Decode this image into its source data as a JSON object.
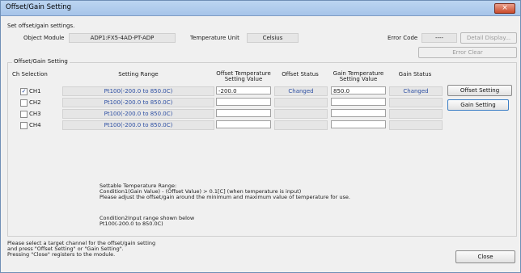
{
  "window": {
    "title": "Offset/Gain Setting",
    "close_glyph": "×"
  },
  "intro": "Set offset/gain settings.",
  "module": {
    "label": "Object Module",
    "value": "ADP1:FX5-4AD-PT-ADP"
  },
  "temp_unit": {
    "label": "Temperature Unit",
    "value": "Celsius"
  },
  "error": {
    "label": "Error Code",
    "value": "----",
    "detail_label": "Detail Display...",
    "clear_label": "Error Clear"
  },
  "group_label": "Offset/Gain Setting",
  "headers": {
    "ch": "Ch Selection",
    "range": "Setting Range",
    "offset_val": "Offset Temperature\nSetting Value",
    "offset_status": "Offset Status",
    "gain_val": "Gain Temperature\nSetting Value",
    "gain_status": "Gain Status"
  },
  "channels": [
    {
      "name": "CH1",
      "checked": true,
      "range": "Pt100(-200.0 to 850.0C)",
      "offset": "-200.0",
      "offset_status": "Changed",
      "gain": "850.0",
      "gain_status": "Changed"
    },
    {
      "name": "CH2",
      "checked": false,
      "range": "Pt100(-200.0 to 850.0C)",
      "offset": "",
      "offset_status": "",
      "gain": "",
      "gain_status": ""
    },
    {
      "name": "CH3",
      "checked": false,
      "range": "Pt100(-200.0 to 850.0C)",
      "offset": "",
      "offset_status": "",
      "gain": "",
      "gain_status": ""
    },
    {
      "name": "CH4",
      "checked": false,
      "range": "Pt100(-200.0 to 850.0C)",
      "offset": "",
      "offset_status": "",
      "gain": "",
      "gain_status": ""
    }
  ],
  "buttons": {
    "offset_setting": "Offset Setting",
    "gain_setting": "Gain Setting",
    "close": "Close"
  },
  "range_note": "Settable Temperature Range:\nCondition1(Gain Value) - (Offset Value) > 0.1[C] (when temperature is input)\nPlease adjust the offset/gain around the minimum and maximum value of temperature for use.",
  "cond2_note": "Condition2Input range shown below\nPt100(-200.0 to 850.0C)",
  "footer_note": "Please select a target channel for the offset/gain setting\nand press \"Offset Setting\" or \"Gain Setting\".\nPressing \"Close\" registers to the module.",
  "check_glyph": "✓"
}
